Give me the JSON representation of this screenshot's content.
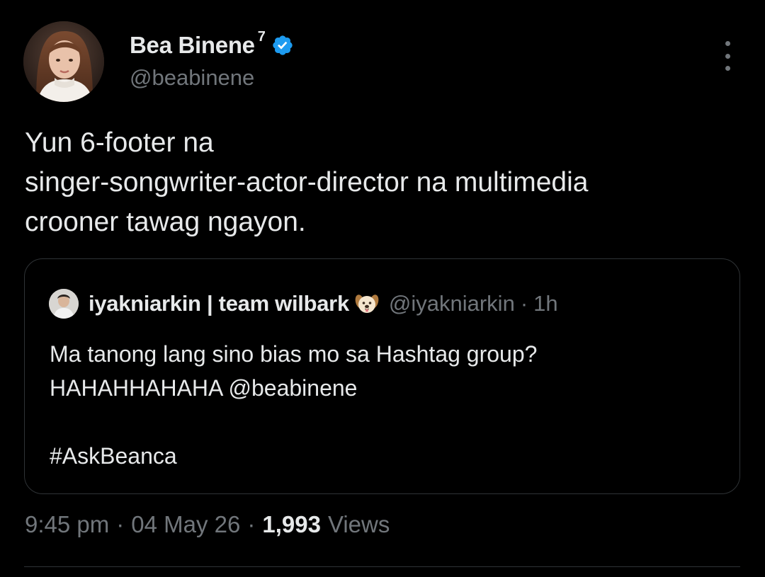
{
  "author": {
    "name": "Bea Binene",
    "name_superscript": "7",
    "handle": "@beabinene",
    "verified_icon": "verified-badge-icon",
    "more_icon": "more-options-icon"
  },
  "tweet": {
    "lines": [
      "Yun 6-footer na",
      "singer-songwriter-actor-director na multimedia",
      "crooner tawag ngayon."
    ]
  },
  "quoted_tweet": {
    "author_name": "iyakniarkin | team wilbark",
    "emoji_icon": "dog-face-icon",
    "handle": "@iyakniarkin",
    "separator": "·",
    "time": "1h",
    "lines": [
      "Ma tanong lang sino bias mo sa Hashtag group?",
      "HAHAHHAHAHA @beabinene",
      "",
      "#AskBeanca"
    ]
  },
  "meta": {
    "time": "9:45 pm",
    "separator": "·",
    "date": "04 May 26",
    "views_count": "1,993",
    "views_label": "Views"
  },
  "colors": {
    "background": "#000000",
    "text_primary": "#e7e9ea",
    "text_secondary": "#71767b",
    "border": "#2f3336",
    "verified_blue": "#1d9bf0"
  }
}
